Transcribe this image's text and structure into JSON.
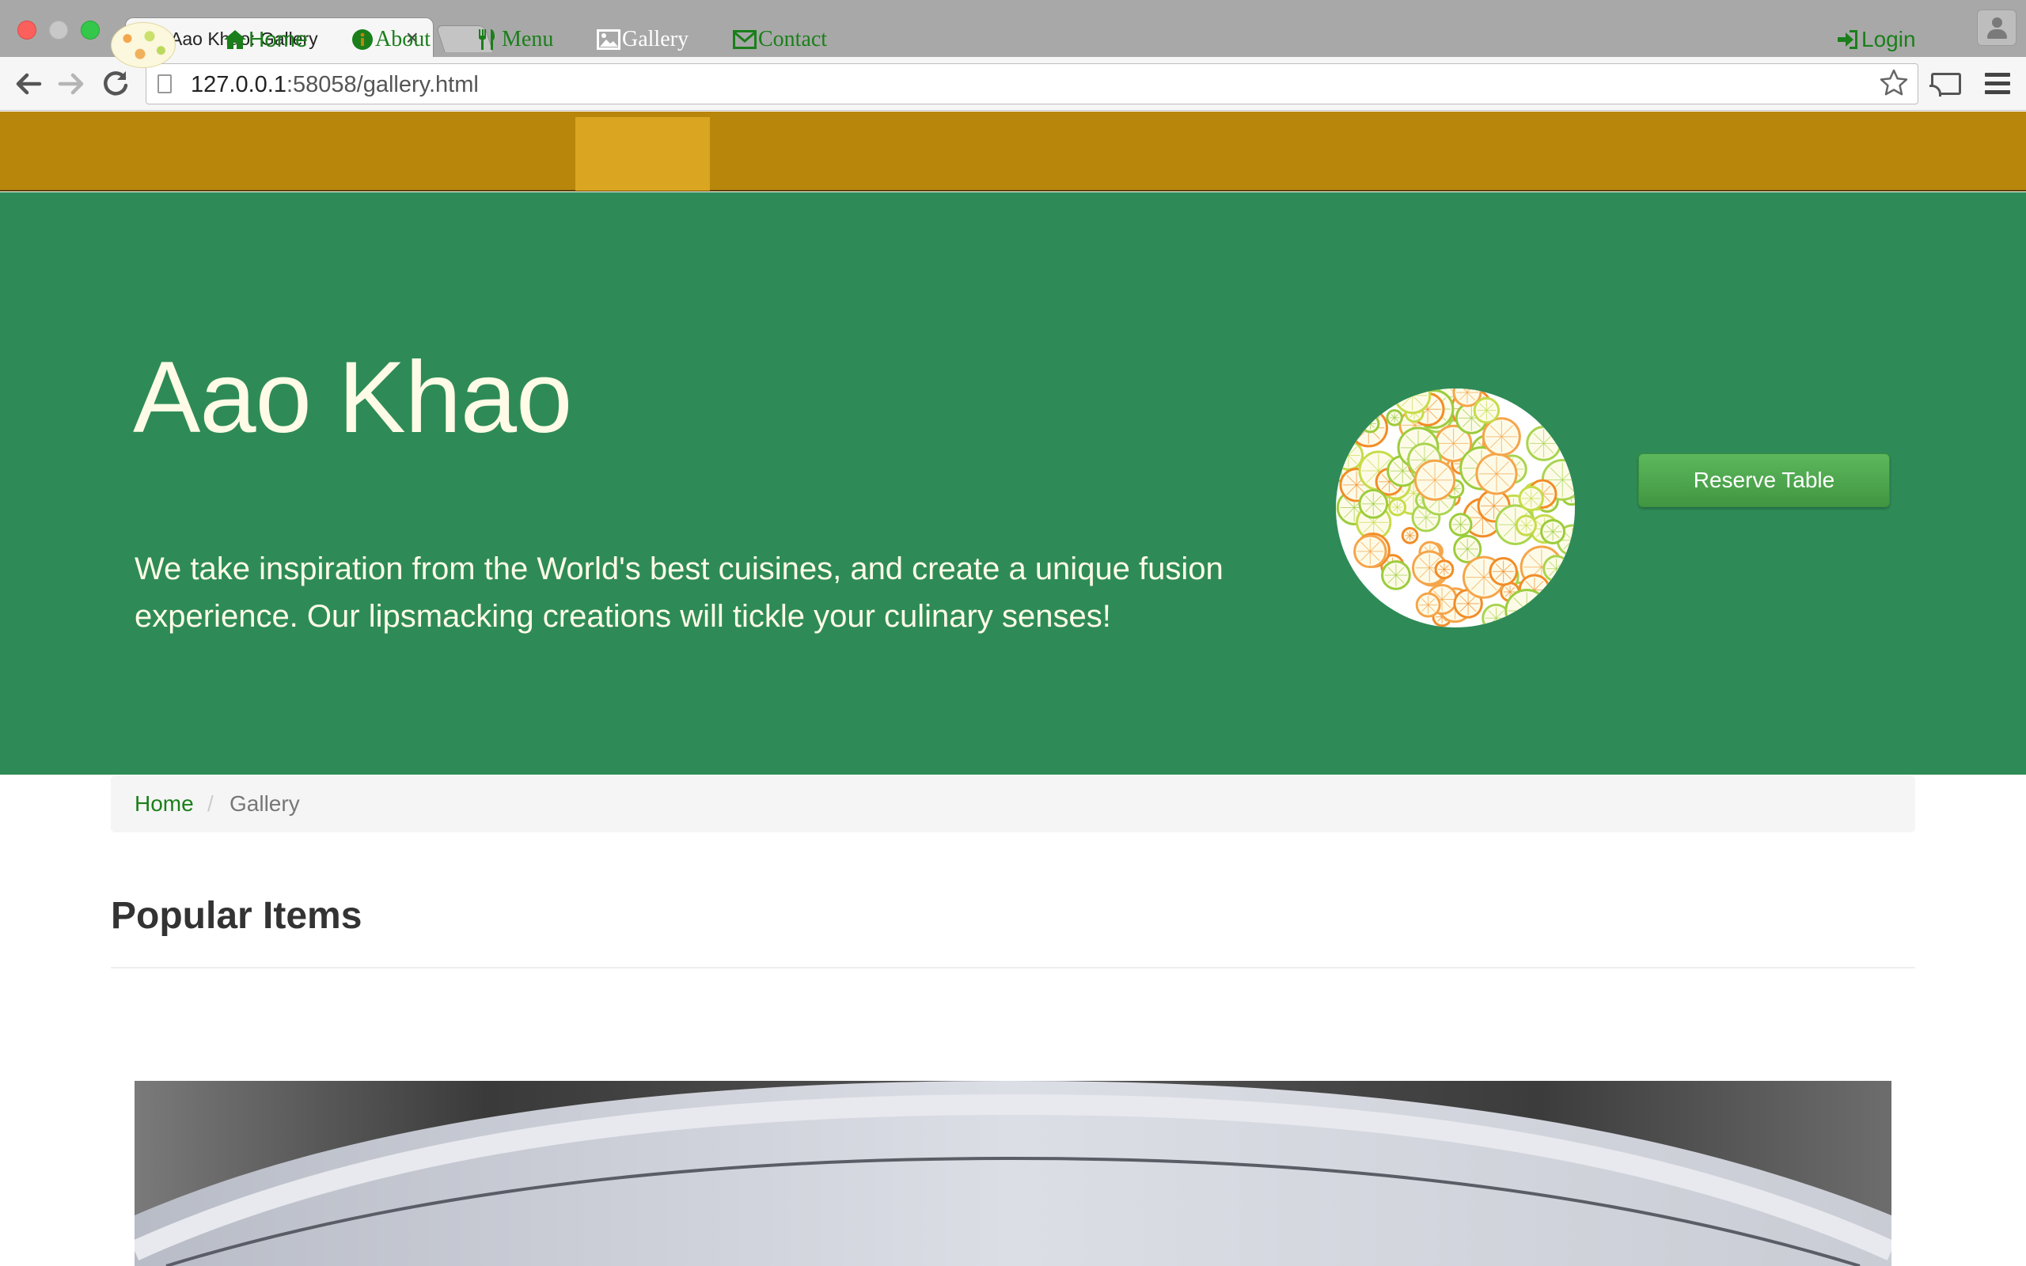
{
  "browser": {
    "tab_title": "Aao Khao: Gallery",
    "tab_close": "×",
    "url_host": "127.0.0.1",
    "url_rest": ":58058/gallery.html"
  },
  "navbar": {
    "items": [
      {
        "label": "Home",
        "icon": "home-icon"
      },
      {
        "label": "About",
        "icon": "info-icon"
      },
      {
        "label": "Menu",
        "icon": "cutlery-icon"
      },
      {
        "label": "Gallery",
        "icon": "picture-icon",
        "active": true
      },
      {
        "label": "Contact",
        "icon": "envelope-icon"
      }
    ],
    "login_label": "Login",
    "colors": {
      "bar": "#b8860b",
      "active": "#daa520",
      "link": "#1a7f1a"
    }
  },
  "hero": {
    "title": "Aao Khao",
    "tagline": "We take inspiration from the World's best cuisines, and create a unique fusion experience. Our lipsmacking creations will tickle your culinary senses!",
    "reserve_label": "Reserve Table",
    "background": "#2e8b57"
  },
  "breadcrumb": {
    "home": "Home",
    "separator": "/",
    "current": "Gallery"
  },
  "content": {
    "section_title": "Popular Items"
  }
}
